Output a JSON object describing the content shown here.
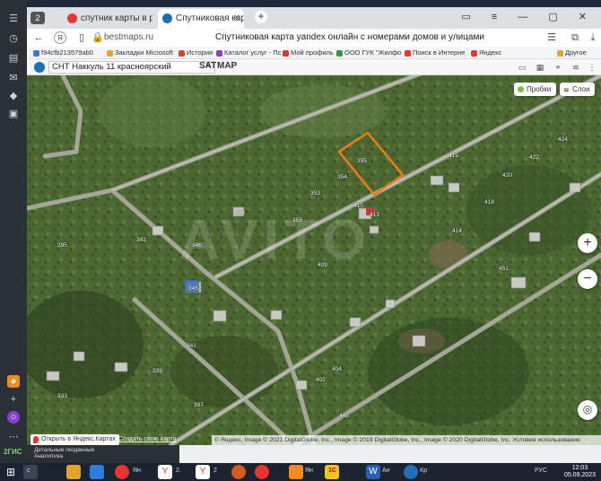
{
  "browser": {
    "tab_counter": "2",
    "tabs": [
      {
        "label": "спутник карты в реально",
        "active": false,
        "favicon_color": "#e8352e"
      },
      {
        "label": "Спутниковая карта yande",
        "active": true,
        "favicon_color": "#1d6fb8"
      }
    ],
    "new_tab_label": "+",
    "url": "bestmaps.ru",
    "page_title": "Спутниковая карта yandex онлайн с номерами домов и улицами"
  },
  "bookmarks": [
    {
      "label": "f94cfb213579ab0",
      "color": "#4a76c6"
    },
    {
      "label": "Закладки Microsoft",
      "color": "#e2a52b"
    },
    {
      "label": "История",
      "color": "#d04a2a"
    },
    {
      "label": "Каталог услуг - Пс",
      "color": "#8a3fc7"
    },
    {
      "label": "Мой профиль",
      "color": "#e0352a"
    },
    {
      "label": "ООО ГУК \"Жилфо",
      "color": "#2e9a3c"
    },
    {
      "label": "Поиск в Интерне",
      "color": "#e8352e"
    },
    {
      "label": "Яндекс",
      "color": "#e8352e"
    },
    {
      "label": "Другое",
      "color": "#e2a52b"
    }
  ],
  "site": {
    "search_value": "СНТ Наккуль 11 красноярский",
    "mode_sat": "SAT",
    "mode_map": "MAP"
  },
  "map": {
    "traffic_button": "Пробки",
    "layers_button": "Слои",
    "zoom_in": "+",
    "zoom_out": "−",
    "open_in_yandex": "Открыть в Яндекс.Картах",
    "create_map": "Создать свою карту",
    "copyright": "© Яндекс, Image © 2021 DigitalGlobe, Inc., Image © 2019 DigitalGlobe, Inc., Image © 2020 DigitalGlobe, Inc.  Условия использования",
    "watermark": "AVITO",
    "plot_numbers": [
      "419",
      "424",
      "422",
      "420",
      "418",
      "414",
      "451",
      "354",
      "355",
      "353",
      "359",
      "346",
      "348",
      "345",
      "342",
      "341",
      "339",
      "333",
      "397",
      "409",
      "404",
      "402",
      "445",
      "410",
      "413",
      "295"
    ],
    "highlight_color": "#f07a1a"
  },
  "ad": {
    "line1": "Детальные геоданные",
    "line2": "Аналитика",
    "brand": "2ГИС"
  },
  "taskbar": {
    "apps": [
      "с",
      "Ян",
      "Я",
      "2.",
      "Я",
      "2",
      "Ян",
      "1С",
      "Ан",
      "W",
      "Ан",
      "Кр"
    ],
    "language": "РУС",
    "time": "12:03",
    "date": "05.09.2023"
  }
}
